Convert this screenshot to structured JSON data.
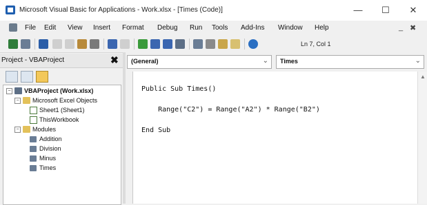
{
  "window": {
    "title": "Microsoft Visual Basic for Applications - Work.xlsx - [Times (Code)]",
    "minimize": "—",
    "maximize": "☐",
    "close": "✕"
  },
  "menu": {
    "items": [
      "File",
      "Edit",
      "View",
      "Insert",
      "Format",
      "Debug",
      "Run",
      "Tools",
      "Add-Ins",
      "Window",
      "Help"
    ],
    "mdi_minimize": "_",
    "mdi_close": "✖"
  },
  "toolbar": {
    "status": "Ln 7, Col 1"
  },
  "project": {
    "title": "Project - VBAProject",
    "close": "✖",
    "tree": {
      "root": "VBAProject (Work.xlsx)",
      "excel_objects_folder": "Microsoft Excel Objects",
      "sheet": "Sheet1 (Sheet1)",
      "workbook": "ThisWorkbook",
      "modules_folder": "Modules",
      "modules": [
        "Addition",
        "Division",
        "Minus",
        "Times"
      ]
    }
  },
  "code": {
    "object_combo": "(General)",
    "procedure_combo": "Times",
    "lines": [
      "Public Sub Times()",
      "    Range(\"C2\") = Range(\"A2\") * Range(\"B2\")",
      "End Sub"
    ]
  },
  "colors": {
    "accent": "#1f5fb0",
    "folder": "#e3c15a",
    "module": "#6a7d95"
  }
}
